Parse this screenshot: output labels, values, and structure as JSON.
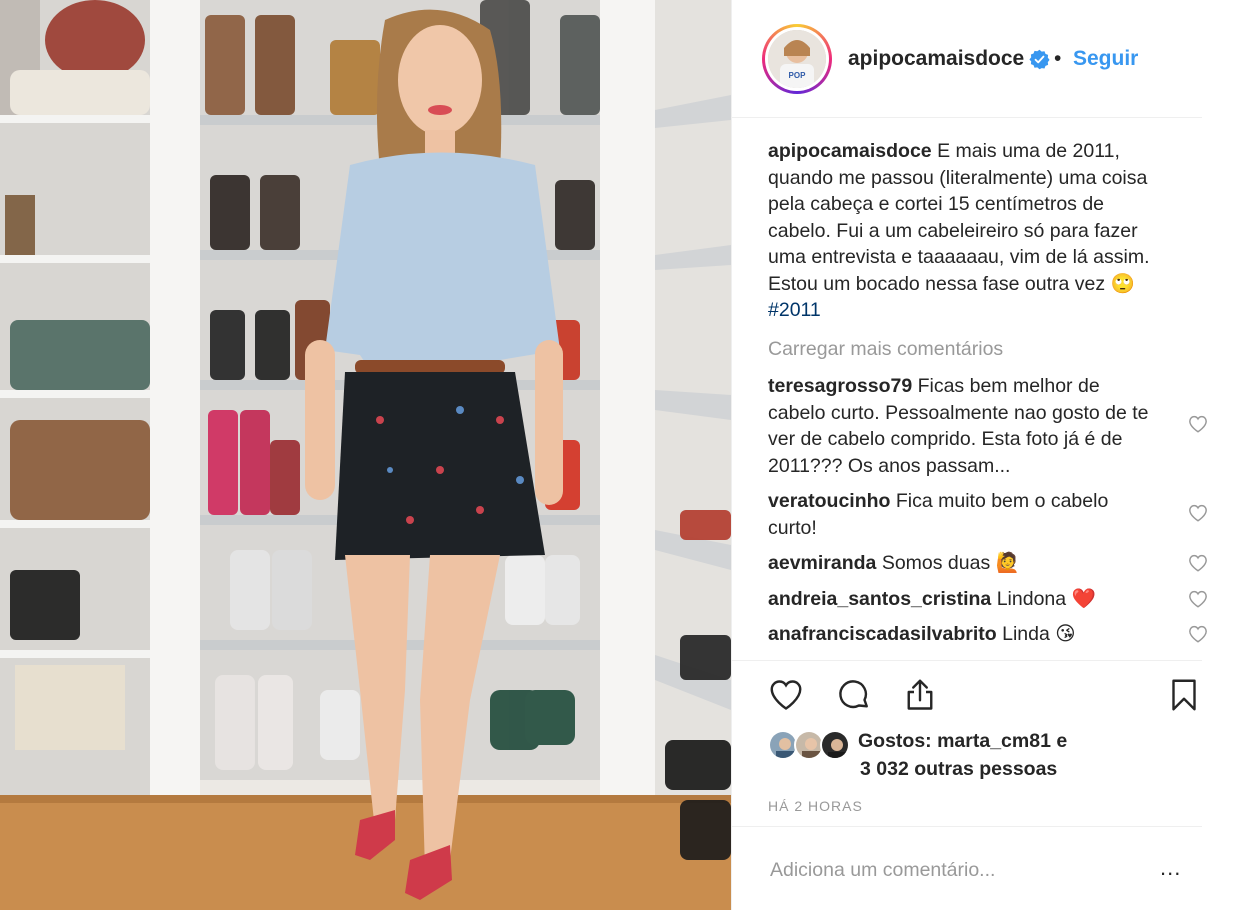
{
  "post": {
    "author": {
      "username": "apipocamaisdoce",
      "verified": true,
      "follow_label": "Seguir",
      "separator": "•"
    },
    "caption": {
      "username": "apipocamaisdoce",
      "text": "E mais uma de 2011, quando me passou (literalmente) uma coisa pela cabeça e cortei 15 centímetros de cabelo. Fui a um cabeleireiro só para fazer uma entrevista e taaaaaau, vim de lá assim. Estou um bocado nessa fase outra vez 🙄",
      "hashtag": "#2011"
    },
    "load_more_label": "Carregar mais comentários",
    "comments": [
      {
        "username": "teresagrosso79",
        "text": "Ficas bem melhor de cabelo curto. Pessoalmente nao gosto de te ver de cabelo comprido. Esta foto já é de 2011??? Os anos passam..."
      },
      {
        "username": "veratoucinho",
        "text": "Fica muito bem o cabelo curto!"
      },
      {
        "username": "aevmiranda",
        "text": "Somos duas 🙋"
      },
      {
        "username": "andreia_santos_cristina",
        "text": "Lindona ❤️"
      },
      {
        "username": "anafranciscadasilvabrito",
        "text": "Linda 😘"
      }
    ],
    "likes": {
      "prefix": "Gostos: ",
      "first_user": "marta_cm81",
      "conjunction": " e",
      "others": "3 032 outras pessoas"
    },
    "time_ago": "HÁ 2 HORAS",
    "add_comment_placeholder": "Adiciona um comentário...",
    "more_options": "..."
  },
  "colors": {
    "link_blue": "#3897f0",
    "hashtag_blue": "#003569",
    "muted_gray": "#999999",
    "text_dark": "#262626"
  },
  "icons": {
    "like": "heart-icon",
    "comment": "comment-bubble-icon",
    "share": "share-icon",
    "save": "bookmark-icon",
    "verified": "verified-badge-icon"
  }
}
